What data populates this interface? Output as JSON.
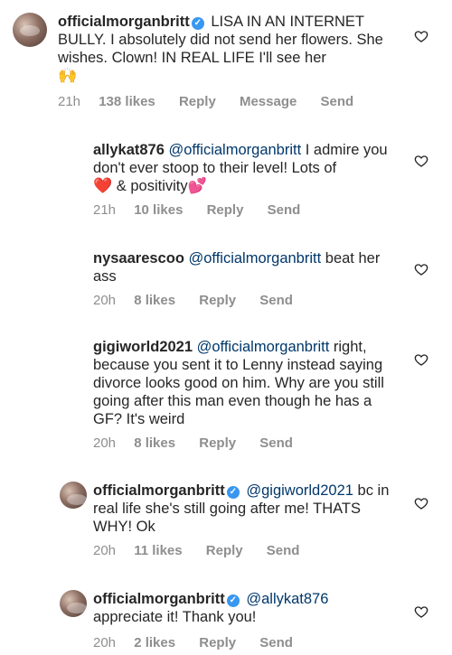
{
  "comments": [
    {
      "username": "officialmorganbritt",
      "text": "LISA IN AN INTERNET BULLY. I absolutely did not send her flowers. She wishes. Clown! IN REAL LIFE I'll see her",
      "emoji": "🙌",
      "time": "21h",
      "likes": "138 likes",
      "actions": [
        "Reply",
        "Message",
        "Send"
      ]
    },
    {
      "username": "allykat876",
      "mention": "@officialmorganbritt",
      "text": "I admire you don't ever stoop to their level! Lots of",
      "emoji1": "❤️",
      "text2": "& positivity",
      "emoji2": "💕",
      "time": "21h",
      "likes": "10 likes",
      "actions": [
        "Reply",
        "Send"
      ]
    },
    {
      "username": "nysaarescoo",
      "mention": "@officialmorganbritt",
      "text": "beat her ass",
      "time": "20h",
      "likes": "8 likes",
      "actions": [
        "Reply",
        "Send"
      ]
    },
    {
      "username": "gigiworld2021",
      "mention": "@officialmorganbritt",
      "text": "right, because you sent it to Lenny instead saying divorce looks good on him. Why are you still going after this man even though he has a GF? It's weird",
      "time": "20h",
      "likes": "8 likes",
      "actions": [
        "Reply",
        "Send"
      ]
    },
    {
      "username": "officialmorganbritt",
      "mention": "@gigiworld2021",
      "text": "bc in real life she's still going after me! THATS WHY! Ok",
      "time": "20h",
      "likes": "11 likes",
      "actions": [
        "Reply",
        "Send"
      ]
    },
    {
      "username": "officialmorganbritt",
      "mention": "@allykat876",
      "text": "appreciate it! Thank you!",
      "time": "20h",
      "likes": "2 likes",
      "actions": [
        "Reply",
        "Send"
      ]
    }
  ],
  "colors": {
    "verified": "#3897f0",
    "mention": "#00376b",
    "meta": "#8e8e8e"
  },
  "icons": {
    "like": "heart-outline-icon",
    "verified": "verified-badge-icon"
  }
}
